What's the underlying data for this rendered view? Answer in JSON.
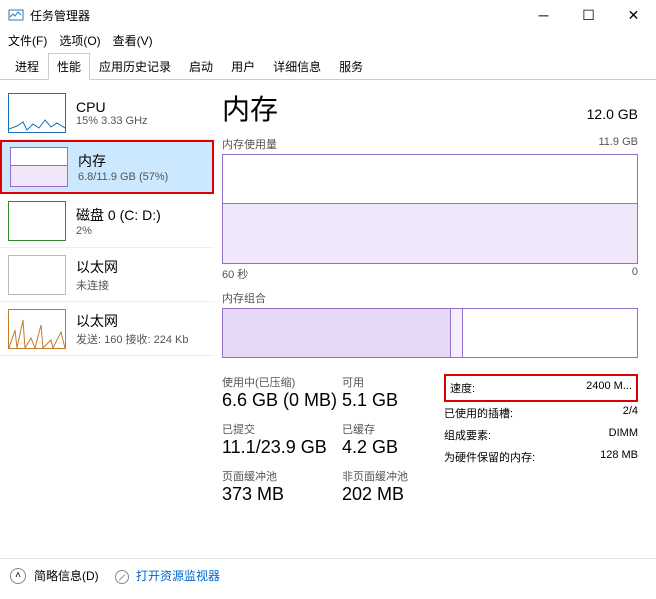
{
  "window": {
    "title": "任务管理器"
  },
  "menu": {
    "file": "文件(F)",
    "options": "选项(O)",
    "view": "查看(V)"
  },
  "tabs": [
    "进程",
    "性能",
    "应用历史记录",
    "启动",
    "用户",
    "详细信息",
    "服务"
  ],
  "active_tab": "性能",
  "sidebar": {
    "items": [
      {
        "name": "CPU",
        "sub": "15% 3.33 GHz"
      },
      {
        "name": "内存",
        "sub": "6.8/11.9 GB (57%)"
      },
      {
        "name": "磁盘 0 (C: D:)",
        "sub": "2%"
      },
      {
        "name": "以太网",
        "sub": "未连接"
      },
      {
        "name": "以太网",
        "sub": "发送: 160 接收: 224 Kb"
      }
    ]
  },
  "main": {
    "title": "内存",
    "total": "12.0 GB",
    "usage_chart": {
      "label": "内存使用量",
      "max": "11.9 GB",
      "x_left": "60 秒",
      "x_right": "0"
    },
    "comp_chart": {
      "label": "内存组合"
    },
    "stats": {
      "in_use_label": "使用中(已压缩)",
      "in_use": "6.6 GB (0 MB)",
      "avail_label": "可用",
      "avail": "5.1 GB",
      "commit_label": "已提交",
      "commit": "11.1/23.9 GB",
      "cached_label": "已缓存",
      "cached": "4.2 GB",
      "paged_label": "页面缓冲池",
      "paged": "373 MB",
      "nonpaged_label": "非页面缓冲池",
      "nonpaged": "202 MB"
    },
    "info": {
      "speed_label": "速度:",
      "speed": "2400 M...",
      "slots_label": "已使用的插槽:",
      "slots": "2/4",
      "form_label": "组成要素:",
      "form": "DIMM",
      "reserved_label": "为硬件保留的内存:",
      "reserved": "128 MB"
    }
  },
  "footer": {
    "fewer": "简略信息(D)",
    "resmon": "打开资源监视器"
  }
}
